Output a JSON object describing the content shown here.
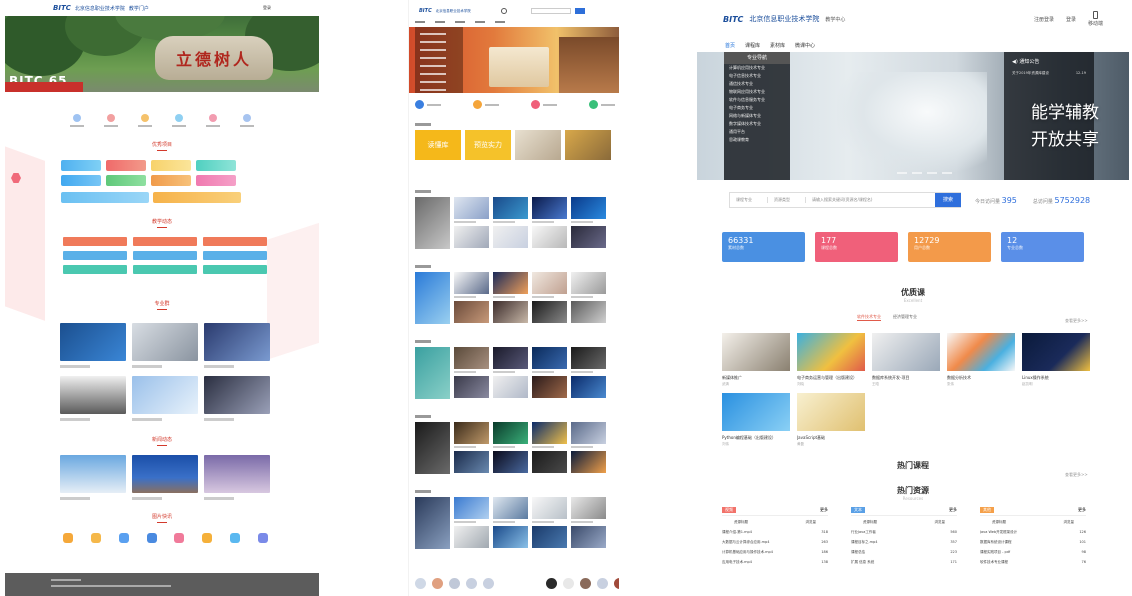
{
  "portal": {
    "logo_mark": "BITC",
    "logo_text": "北京信息职业技术学院",
    "logo_suffix": "教学门户",
    "login": "登录",
    "hero_slogan": "立德树人",
    "hero_badge": "BITC 65",
    "sections": [
      "优秀项目",
      "教学动态",
      "专业群",
      "新闻动态",
      "图片快讯"
    ]
  },
  "library": {
    "logo_text": "北京信息职业技术学院",
    "search_button": "搜索",
    "banner_tags": [
      "读懂库",
      "预览实力"
    ]
  },
  "center": {
    "logo_mark": "BITC",
    "logo_text": "北京信息职业技术学院",
    "subtitle": "教学中心",
    "header_links": [
      "注册登录",
      "登录"
    ],
    "mobile_label": "移动端",
    "nav": [
      "首页",
      "课程库",
      "素材库",
      "微课中心"
    ],
    "side_menu": {
      "title": "专业导航",
      "items": [
        "计算机应用技术专业",
        "电子信息技术专业",
        "通信技术专业",
        "物联网应用技术专业",
        "软件与信息服务专业",
        "电子商务专业",
        "网络与新媒体专业",
        "数字媒体技术专业",
        "通用平台",
        "思政课教育"
      ]
    },
    "notice": {
      "title": "通知公告",
      "items": [
        {
          "text": "关于2019年资源库建设",
          "date": "12-19"
        }
      ]
    },
    "slogan": [
      "能学辅教",
      "开放共享"
    ],
    "search": {
      "select1": "课程专业",
      "select2": "资源类型",
      "placeholder": "请输入搜索关键词(资源名/课程名)",
      "button": "搜索"
    },
    "counters": [
      {
        "label": "今日访问量",
        "value": "395"
      },
      {
        "label": "总访问量",
        "value": "5752928"
      }
    ],
    "tiles": [
      {
        "value": "66331",
        "label": "素材总数",
        "color": "#4a90e2"
      },
      {
        "value": "177",
        "label": "课程总数",
        "color": "#f0607a"
      },
      {
        "value": "12729",
        "label": "用户总数",
        "color": "#f39a4a"
      },
      {
        "value": "12",
        "label": "专业总数",
        "color": "#5a8fe8"
      }
    ],
    "featured": {
      "title": "优质课",
      "subtitle": "Excellent",
      "tabs": [
        "软件技术专业",
        "经济管理专业"
      ],
      "more": "查看更多>>",
      "courses": [
        {
          "title": "新媒体推广",
          "sub": "武清"
        },
        {
          "title": "电子商务运营与管理（出版建设）",
          "sub": "刘晓"
        },
        {
          "title": "数据库系统开发-项目",
          "sub": "王晗"
        },
        {
          "title": "数据分析技术",
          "sub": "张伟"
        },
        {
          "title": "Linux操作系统",
          "sub": "赵凯明"
        },
        {
          "title": "Python编程基础（出版建设）",
          "sub": "刘伟"
        },
        {
          "title": "JavaScript基础",
          "sub": "黄磊"
        }
      ]
    },
    "hot_course_title": "热门课程",
    "hot_resource_title": "热门资源",
    "hot_resource_sub": "Resources",
    "hot_more": "查看更多>>",
    "lists": [
      {
        "tag": "视频",
        "tag_color": "#f2726a",
        "more": "更多",
        "col1": "资源标题",
        "col2": "浏览量",
        "rows": [
          [
            "课程介绍-第1.mp4",
            "318"
          ],
          [
            "大数据与云计算综合应用.mp4",
            "263"
          ],
          [
            "计算机基础应用与操作技术.mp4",
            "186"
          ],
          [
            "应用电子技术.mp4",
            "138"
          ]
        ]
      },
      {
        "tag": "文本",
        "tag_color": "#5aa0e6",
        "more": "更多",
        "col1": "资源标题",
        "col2": "浏览量",
        "rows": [
          [
            "行业Java工作者",
            "560"
          ],
          [
            "课程目标之.mp4",
            "357"
          ],
          [
            "课程总结",
            "223"
          ],
          [
            "扩展 信息 系统",
            "171"
          ]
        ]
      },
      {
        "tag": "其他",
        "tag_color": "#f5a04a",
        "more": "更多",
        "col1": "资源标题",
        "col2": "浏览量",
        "rows": [
          [
            "Java Web开发框架设计",
            "126"
          ],
          [
            "数据库系统设计课程",
            "101"
          ],
          [
            "课程实践项目 - pdf",
            "98"
          ],
          [
            "软件技术专业课程",
            "76"
          ]
        ]
      }
    ]
  },
  "colors": {
    "brand_blue": "#1b4e9b",
    "accent_red": "#d33a2c",
    "link_blue": "#2f6fdc"
  }
}
